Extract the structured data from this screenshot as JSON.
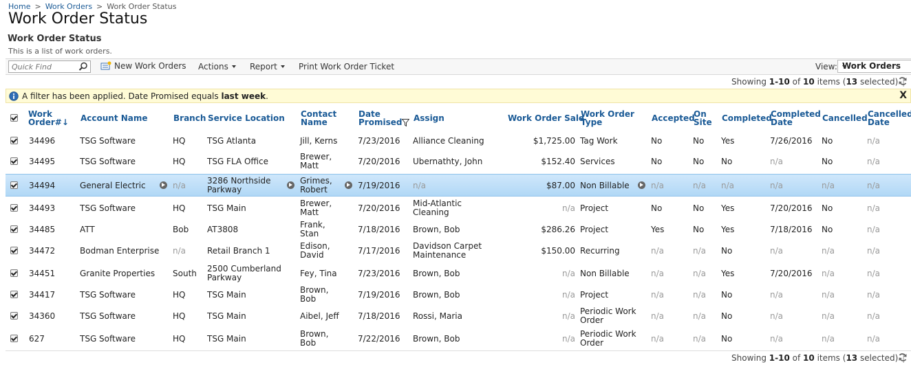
{
  "breadcrumb": [
    "Home",
    "Work Orders",
    "Work Order Status"
  ],
  "page_title": "Work Order Status",
  "subtitle": "Work Order Status",
  "description": "This is a list of work orders.",
  "toolbar": {
    "quick_find_placeholder": "Quick Find",
    "new_label": "New Work Orders",
    "actions_label": "Actions",
    "report_label": "Report",
    "print_label": "Print Work Order Ticket",
    "view_label": "View:",
    "view_value": "Work Orders"
  },
  "showing": {
    "prefix": "Showing",
    "range": "1-10",
    "of": "of",
    "total": "10",
    "items": "items",
    "selected_count": "13",
    "selected_word": "selected"
  },
  "filter": {
    "text": "A filter has been applied. Date Promised equals",
    "value": "last week",
    "suffix": ".",
    "close": "X"
  },
  "columns": {
    "work_order_1": "Work",
    "work_order_2": "Order#↓",
    "account": "Account Name",
    "branch": "Branch",
    "service": "Service Location",
    "contact_1": "Contact",
    "contact_2": "Name",
    "date_1": "Date",
    "date_2": "Promised",
    "assign": "Assign",
    "sale": "Work Order Sale",
    "type_1": "Work Order",
    "type_2": "Type",
    "accepted": "Accepted",
    "onsite_1": "On",
    "onsite_2": "Site",
    "completed": "Completed",
    "cdate_1": "Completed",
    "cdate_2": "Date",
    "cancelled": "Cancelled",
    "xdate_1": "Cancelled",
    "xdate_2": "Date"
  },
  "rows": [
    {
      "wo": "34496",
      "account": "TSG Software",
      "branch": "HQ",
      "service": "TSG Atlanta",
      "contact": "Jill, Kerns",
      "date": "7/23/2016",
      "assign": "Alliance Cleaning",
      "sale": "$1,725.00",
      "type": "Tag Work",
      "accepted": "No",
      "onsite": "No",
      "completed": "Yes",
      "cdate": "7/26/2016",
      "cancelled": "No",
      "xdate": "n/a"
    },
    {
      "wo": "34495",
      "account": "TSG Software",
      "branch": "HQ",
      "service": "TSG FLA Office",
      "contact": "Brewer, Matt",
      "date": "7/20/2016",
      "assign": "Ubernathty, John",
      "sale": "$152.40",
      "type": "Services",
      "accepted": "No",
      "onsite": "No",
      "completed": "No",
      "cdate": "n/a",
      "cancelled": "No",
      "xdate": "n/a"
    },
    {
      "wo": "34494",
      "account": "General Electric",
      "branch": "n/a",
      "service": "3286 Northside Parkway",
      "contact": "Grimes, Robert",
      "date": "7/19/2016",
      "assign": "n/a",
      "sale": "$87.00",
      "type": "Non Billable",
      "accepted": "n/a",
      "onsite": "n/a",
      "completed": "n/a",
      "cdate": "n/a",
      "cancelled": "n/a",
      "xdate": "n/a"
    },
    {
      "wo": "34493",
      "account": "TSG Software",
      "branch": "HQ",
      "service": "TSG Main",
      "contact": "Brewer, Matt",
      "date": "7/20/2016",
      "assign": "Mid-Atlantic Cleaning",
      "sale": "n/a",
      "type": "Project",
      "accepted": "No",
      "onsite": "No",
      "completed": "Yes",
      "cdate": "7/20/2016",
      "cancelled": "No",
      "xdate": "n/a"
    },
    {
      "wo": "34485",
      "account": "ATT",
      "branch": "Bob",
      "service": "AT3808",
      "contact": "Frank, Stan",
      "date": "7/18/2016",
      "assign": "Brown, Bob",
      "sale": "$286.26",
      "type": "Project",
      "accepted": "Yes",
      "onsite": "No",
      "completed": "Yes",
      "cdate": "7/18/2016",
      "cancelled": "No",
      "xdate": "n/a"
    },
    {
      "wo": "34472",
      "account": "Bodman Enterprise",
      "branch": "n/a",
      "service": "Retail Branch 1",
      "contact": "Edison, David",
      "date": "7/17/2016",
      "assign": "Davidson Carpet Maintenance",
      "sale": "$150.00",
      "type": "Recurring",
      "accepted": "n/a",
      "onsite": "n/a",
      "completed": "No",
      "cdate": "n/a",
      "cancelled": "n/a",
      "xdate": "n/a"
    },
    {
      "wo": "34451",
      "account": "Granite Properties",
      "branch": "South",
      "service": "2500 Cumberland Parkway",
      "contact": "Fey, Tina",
      "date": "7/23/2016",
      "assign": "Brown, Bob",
      "sale": "n/a",
      "type": "Non Billable",
      "accepted": "n/a",
      "onsite": "n/a",
      "completed": "Yes",
      "cdate": "7/20/2016",
      "cancelled": "n/a",
      "xdate": "n/a"
    },
    {
      "wo": "34417",
      "account": "TSG Software",
      "branch": "HQ",
      "service": "TSG Main",
      "contact": "Brown, Bob",
      "date": "7/19/2016",
      "assign": "Brown, Bob",
      "sale": "n/a",
      "type": "Project",
      "accepted": "n/a",
      "onsite": "n/a",
      "completed": "No",
      "cdate": "n/a",
      "cancelled": "n/a",
      "xdate": "n/a"
    },
    {
      "wo": "34360",
      "account": "TSG Software",
      "branch": "HQ",
      "service": "TSG Main",
      "contact": "Aibel, Jeff",
      "date": "7/18/2016",
      "assign": "Rossi, Maria",
      "sale": "n/a",
      "type": "Periodic Work Order",
      "accepted": "n/a",
      "onsite": "n/a",
      "completed": "No",
      "cdate": "n/a",
      "cancelled": "n/a",
      "xdate": "n/a"
    },
    {
      "wo": "627",
      "account": "TSG Software",
      "branch": "HQ",
      "service": "TSG Main",
      "contact": "Brown, Bob",
      "date": "7/22/2016",
      "assign": "Brown, Bob",
      "sale": "n/a",
      "type": "Periodic Work Order",
      "accepted": "n/a",
      "onsite": "n/a",
      "completed": "No",
      "cdate": "n/a",
      "cancelled": "n/a",
      "xdate": "n/a"
    }
  ]
}
